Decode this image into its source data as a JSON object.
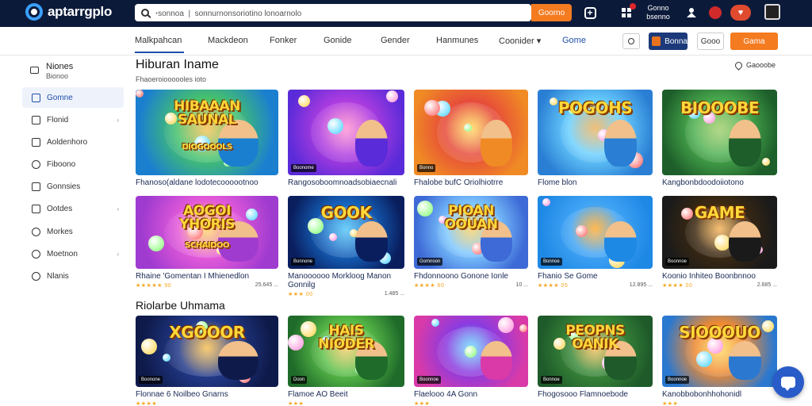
{
  "brand": {
    "name": "aptarrgplo"
  },
  "search": {
    "placeholder": "",
    "value": "ꞏsonnoa  |  sonnurnonsoriotino lonoarnolo",
    "button_label": "Goorno"
  },
  "topbar": {
    "account_label": "Gonno\nbsenno"
  },
  "nav": {
    "tabs": [
      {
        "label": "Malkpahcan"
      },
      {
        "label": "Mackdeon"
      },
      {
        "label": "Fonker"
      },
      {
        "label": "Gonide"
      },
      {
        "label": "Gender"
      },
      {
        "label": "Hanmunes"
      },
      {
        "label": "Coonider ▾"
      },
      {
        "label": "Gome"
      }
    ],
    "blue_button": "Bonna",
    "outline_button": "Gooo",
    "orange_button": "Gama"
  },
  "sidebar": {
    "user": {
      "name": "Niones",
      "sub": "Bionoo"
    },
    "items": [
      {
        "label": "Gomne",
        "active": true
      },
      {
        "label": "Flonid",
        "chevron": true
      },
      {
        "label": "Aoldenhoro"
      },
      {
        "label": "Fiboono"
      },
      {
        "label": "Gonnsies"
      },
      {
        "label": "Ootdes",
        "chevron": true
      },
      {
        "label": "Morkes"
      },
      {
        "label": "Moetnon",
        "chevron": true
      },
      {
        "label": "Nlanis"
      }
    ]
  },
  "main": {
    "title": "Hiburan Iname",
    "subtitle": "Fhaoeroioooooles ioto",
    "filter_label": "Gaooobe",
    "section2_title": "Riolarbe Uhmama"
  },
  "cards": [
    {
      "title": "Fhanoso(aldane lodotecoooootnoo",
      "art": "HIBAAAN\nSAUNAL",
      "artsub": "DIOGOOOLS",
      "palette": [
        "#1b7fd0",
        "#46c26b",
        "#f5b32a"
      ],
      "tag": "",
      "rating": "",
      "plays": ""
    },
    {
      "title": "Rangosoboomnoadsobiaecnali",
      "art": "",
      "artsub": "",
      "palette": [
        "#5a2bd8",
        "#b13de0",
        "#ff79c6"
      ],
      "tag": "Boonome",
      "rating": "",
      "plays": ""
    },
    {
      "title": "Fhalobe bufC Oriolhiotrre",
      "art": "",
      "artsub": "",
      "palette": [
        "#f08a24",
        "#e64a3a",
        "#ffd23f"
      ],
      "tag": "Bonno",
      "rating": "",
      "plays": ""
    },
    {
      "title": "Flome blon",
      "art": "POGOHS",
      "artsub": "",
      "palette": [
        "#2a7fd4",
        "#6bd0ff",
        "#e8a23a"
      ],
      "tag": "",
      "rating": "",
      "plays": ""
    },
    {
      "title": "Kangbonbdoodoiiotono",
      "art": "BIOOOBE",
      "artsub": "",
      "palette": [
        "#1d5e2a",
        "#4caf50",
        "#8bc34a"
      ],
      "tag": "",
      "rating": "",
      "plays": ""
    },
    {
      "title": "Rhaine 'Gomentan I Mhienedlon",
      "art": "AOGOI\nYHORIS",
      "artsub": "SCHAIDOO",
      "palette": [
        "#a03bd0",
        "#e45ad9",
        "#ffcf3d"
      ],
      "tag": "",
      "rating": "★★★★★ 90",
      "plays": "25.645 ..."
    },
    {
      "title": "Manoooooo Morkloog Manon\nGonnilg",
      "art": "GOOK",
      "artsub": "",
      "palette": [
        "#0a1e5e",
        "#1565c0",
        "#29b6f6"
      ],
      "tag": "Bonnone",
      "rating": "★★★ 00",
      "plays": "1.485 ..."
    },
    {
      "title": "Fhdonnoono Gonone Ionle",
      "art": "PIOAN\nOOUAN",
      "artsub": "",
      "palette": [
        "#3d6ad6",
        "#7ec8ff",
        "#f4c542"
      ],
      "tag": "Gomnoon",
      "rating": "★★★★ 60",
      "plays": "10 ..."
    },
    {
      "title": "Fhanio Se Gome",
      "art": "",
      "artsub": "",
      "palette": [
        "#1e88e5",
        "#42a5f5",
        "#ff9800"
      ],
      "tag": "Bonnoe",
      "rating": "★★★★ 05",
      "plays": "12.895 ..."
    },
    {
      "title": "Koonio Inhiteo Boonbnnoo",
      "art": "GAME",
      "artsub": "",
      "palette": [
        "#1a1a1a",
        "#3e2a12",
        "#f0a030"
      ],
      "tag": "Boonnoe",
      "rating": "★★★★ 00",
      "plays": "2.685 ..."
    },
    {
      "title": "Flonnae 6 Noilbeo Gnarns",
      "art": "XGOOOR",
      "artsub": "",
      "palette": [
        "#0e1a4a",
        "#233a8a",
        "#f5b02a"
      ],
      "tag": "Boonone",
      "rating": "★★★★ ",
      "plays": ""
    },
    {
      "title": "Flamoe AO Beeit",
      "art": "HAIS\nNIODER",
      "artsub": "",
      "palette": [
        "#1f6b2a",
        "#5cc04a",
        "#f0c040"
      ],
      "tag": "Doon",
      "rating": "★★★",
      "plays": ""
    },
    {
      "title": "Flaelooo  4A Gonn",
      "art": "",
      "artsub": "",
      "palette": [
        "#d93aa8",
        "#8a3be0",
        "#4fd2ff"
      ],
      "tag": "Boonnoe",
      "rating": "★★★",
      "plays": ""
    },
    {
      "title": "Fhogosooo Flamnoebode",
      "art": "PEOPNS\nOANIK",
      "artsub": "",
      "palette": [
        "#1e5a2a",
        "#3b8a3a",
        "#f0b030"
      ],
      "tag": "Bonnoe",
      "rating": "",
      "plays": ""
    },
    {
      "title": "Kanobbobonhhohonidl",
      "art": "SIOOOUO",
      "artsub": "",
      "palette": [
        "#2a78d0",
        "#f08a30",
        "#ffd23f"
      ],
      "tag": "Boonnoe",
      "rating": "★★★",
      "plays": ""
    }
  ]
}
